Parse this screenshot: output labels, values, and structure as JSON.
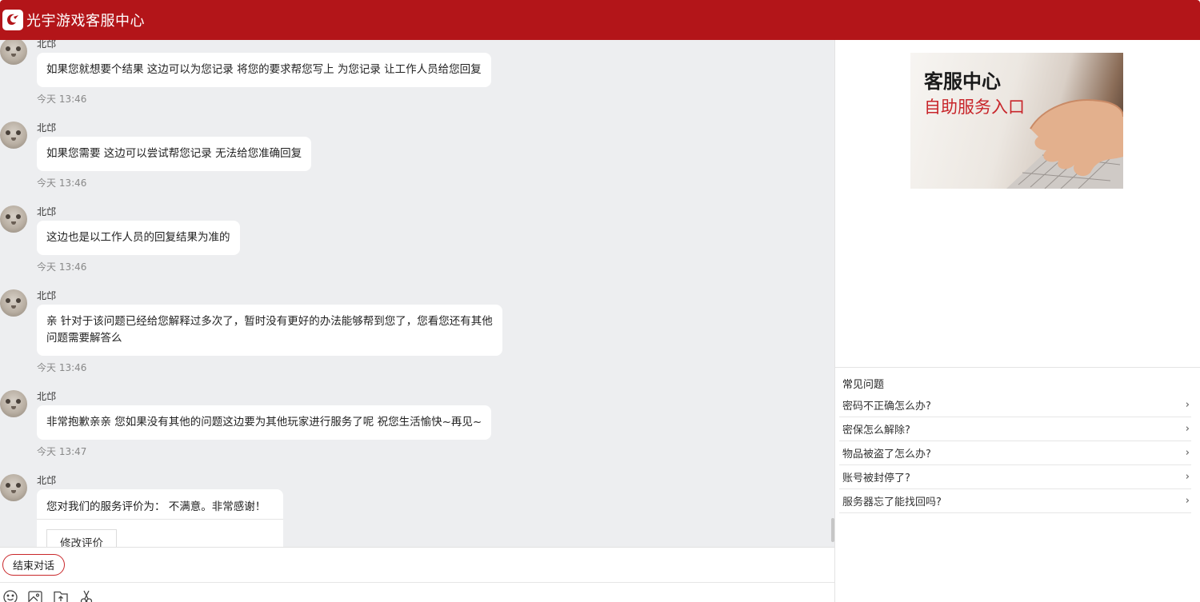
{
  "header": {
    "title": "光宇游戏客服中心"
  },
  "messages": [
    {
      "sender": "北邙",
      "text": "如果您就想要个结果  这边可以为您记录  将您的要求帮您写上   为您记录  让工作人员给您回复",
      "time": "今天 13:46"
    },
    {
      "sender": "北邙",
      "text": "如果您需要  这边可以尝试帮您记录  无法给您准确回复",
      "time": "今天 13:46"
    },
    {
      "sender": "北邙",
      "text": "这边也是以工作人员的回复结果为准的",
      "time": "今天 13:46"
    },
    {
      "sender": "北邙",
      "text_line1": "亲  针对于该问题已经给您解释过多次了，暂时没有更好的办法能够帮到您了，您看您还有其他",
      "text_line2": "问题需要解答么",
      "time": "今天 13:46"
    },
    {
      "sender": "北邙",
      "text": "非常抱歉亲亲 您如果没有其他的问题这边要为其他玩家进行服务了呢  祝您生活愉快~再见~",
      "time": "今天 13:47"
    },
    {
      "sender": "北邙"
    }
  ],
  "rating": {
    "text": "您对我们的服务评价为：  不满意。非常感谢！",
    "modify_label": "修改评价"
  },
  "input": {
    "end_label": "结束对话"
  },
  "banner": {
    "title": "客服中心",
    "subtitle": "自助服务入口"
  },
  "faq": {
    "title": "常见问题",
    "items": [
      {
        "label": "密码不正确怎么办?"
      },
      {
        "label": "密保怎么解除?"
      },
      {
        "label": "物品被盗了怎么办?"
      },
      {
        "label": "账号被封停了?"
      },
      {
        "label": "服务器忘了能找回吗?"
      }
    ]
  },
  "colors": {
    "brand": "#b31519",
    "chat_bg": "#edeef0"
  }
}
